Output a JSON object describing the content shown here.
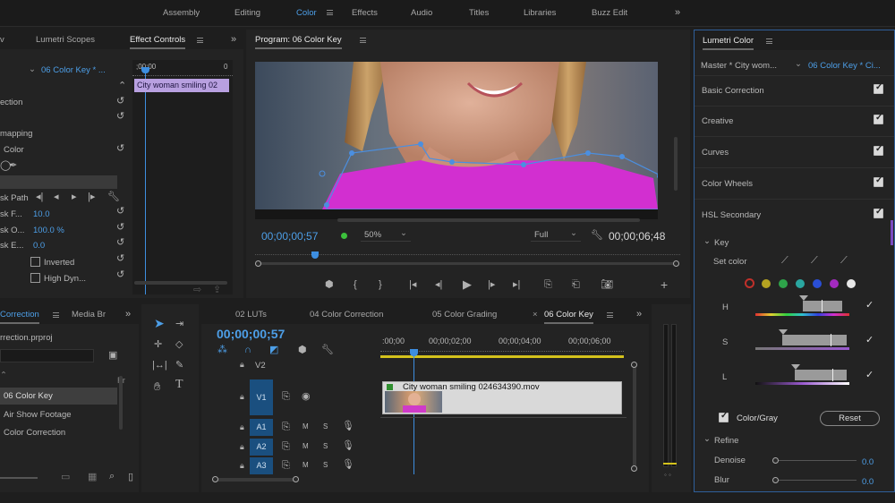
{
  "workspaces": {
    "items": [
      "Assembly",
      "Editing",
      "Color",
      "Effects",
      "Audio",
      "Titles",
      "Libraries",
      "Buzz Edit"
    ],
    "active_index": 2,
    "overflow_icon": "double-chevron-right-icon"
  },
  "left_top_panel": {
    "tabs": [
      "Lumetri Scopes",
      "Effect Controls"
    ],
    "active_tab": "Effect Controls",
    "sequence_label": "06 Color Key * ...",
    "ruler_start": ";00;00",
    "ruler_end": "0",
    "clip_label": "City woman smiling 02",
    "rows": [
      "ection",
      "Color",
      "mapping",
      "sk Path",
      "sk F...",
      "sk O...",
      "sk E..."
    ],
    "row_values": {
      "feather": "10.0",
      "opacity": "100.0 %",
      "expansion": "0.0"
    },
    "inverted_label": "Inverted",
    "high_dyn_label": "High Dyn..."
  },
  "program_monitor": {
    "title": "Program: 06 Color Key",
    "timecode": "00;00;00;57",
    "zoom": "50%",
    "quality": "Full",
    "duration": "00;00;06;48"
  },
  "project_panel": {
    "tabs": [
      "Correction",
      "Media Br"
    ],
    "active_tab": "Correction",
    "file_name": "rrection.prproj",
    "items": [
      "06 Color Key",
      "Air Show Footage",
      "Color Correction"
    ],
    "selected_index": 0,
    "col_header": "Fr"
  },
  "timeline": {
    "tabs": [
      "02 LUTs",
      "04 Color Correction",
      "05 Color Grading",
      "06 Color Key"
    ],
    "active_tab": "06 Color Key",
    "timecode": "00;00;00;57",
    "ruler_labels": [
      ":00;00",
      "00;00;02;00",
      "00;00;04;00",
      "00;00;06;00"
    ],
    "video_tracks": [
      "V2",
      "V1"
    ],
    "audio_tracks": [
      "A1",
      "A2",
      "A3"
    ],
    "clip_name": "City woman smiling 024634390.mov",
    "audio_buttons": {
      "mute": "M",
      "solo": "S"
    }
  },
  "lumetri": {
    "title": "Lumetri Color",
    "master_label": "Master * City wom...",
    "sequence_label": "06 Color Key * Ci...",
    "sections": [
      "Basic Correction",
      "Creative",
      "Curves",
      "Color Wheels",
      "HSL Secondary"
    ],
    "key_label": "Key",
    "set_color_label": "Set color",
    "swatches": [
      "#c0302a",
      "#b5a321",
      "#2ea34a",
      "#2aa6a0",
      "#2a4fd6",
      "#a32ac0",
      "#e8e8e8"
    ],
    "hsl_labels": [
      "H",
      "S",
      "L"
    ],
    "color_gray_label": "Color/Gray",
    "reset_label": "Reset",
    "refine_label": "Refine",
    "denoise_label": "Denoise",
    "denoise_value": "0.0",
    "blur_label": "Blur",
    "blur_value": "0.0"
  }
}
